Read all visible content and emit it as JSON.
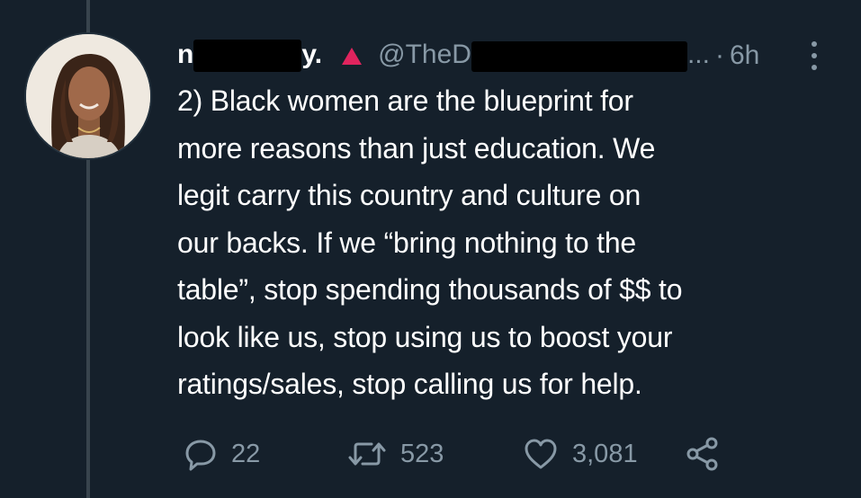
{
  "tweet": {
    "display_name_prefix": "n",
    "display_name_suffix": "y.",
    "handle_prefix": "@TheD",
    "handle_suffix": "...",
    "separator": "·",
    "time": "6h",
    "text": "2) Black women are the blueprint for\nmore reasons than just education. We\nlegit carry this country and culture on\nour backs. If we “bring nothing to the\ntable”, stop spending thousands of $$ to\nlook like us, stop using us to boost your\nratings/sales, stop calling us for help."
  },
  "actions": {
    "replies": "22",
    "retweets": "523",
    "likes": "3,081"
  },
  "icons": {
    "reply": "reply-icon",
    "retweet": "retweet-icon",
    "like": "heart-icon",
    "share": "share-icon",
    "more": "more-vertical-icon",
    "flag": "red-triangle-icon"
  },
  "colors": {
    "background": "#15202b",
    "text": "#ffffff",
    "secondary": "#8899a6",
    "flag": "#e0245e"
  }
}
